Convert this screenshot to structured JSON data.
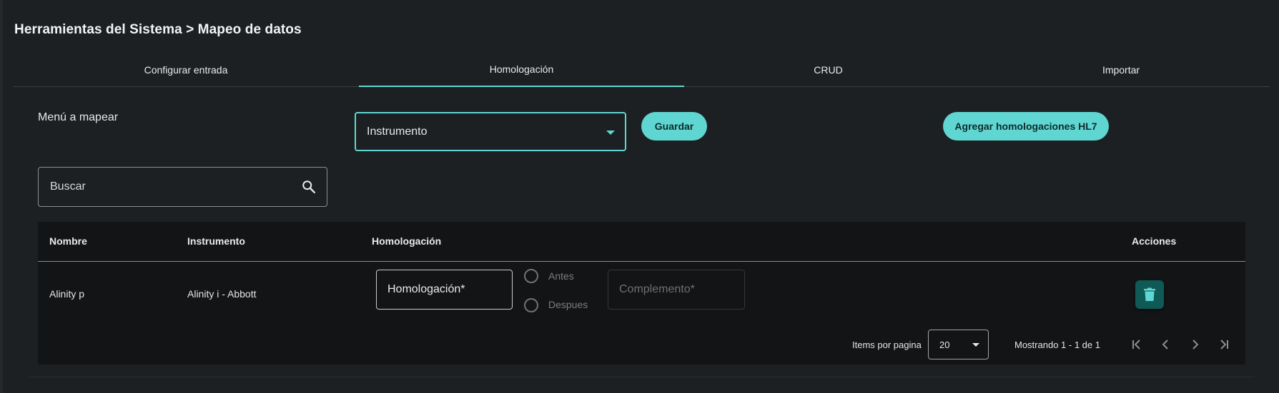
{
  "breadcrumb": {
    "title": "Herramientas del Sistema > Mapeo de datos"
  },
  "tabs": [
    {
      "label": "Configurar entrada",
      "active": false
    },
    {
      "label": "Homologación",
      "active": true
    },
    {
      "label": "CRUD",
      "active": false
    },
    {
      "label": "Importar",
      "active": false
    }
  ],
  "menu": {
    "label": "Menú a mapear",
    "selected": "Instrumento",
    "save_label": "Guardar",
    "add_hl7_label": "Agregar homologaciones HL7"
  },
  "search": {
    "placeholder": "Buscar"
  },
  "table": {
    "headers": {
      "name": "Nombre",
      "instrument": "Instrumento",
      "homologation": "Homologación",
      "actions": "Acciones"
    },
    "rows": [
      {
        "name": "Alinity p",
        "instrument": "Alinity i - Abbott",
        "homologation_placeholder": "Homologación*",
        "radio_before": "Antes",
        "radio_after": "Despues",
        "complement_placeholder": "Complemento*",
        "delete_icon": "trash-icon"
      }
    ]
  },
  "pagination": {
    "items_label": "Items por pagina",
    "page_size": "20",
    "range_text": "Mostrando 1 - 1 de 1"
  },
  "colors": {
    "accent": "#5fd6d1",
    "background": "#1d2022",
    "table_bg": "#121415",
    "delete_bg": "#0f5a57"
  }
}
